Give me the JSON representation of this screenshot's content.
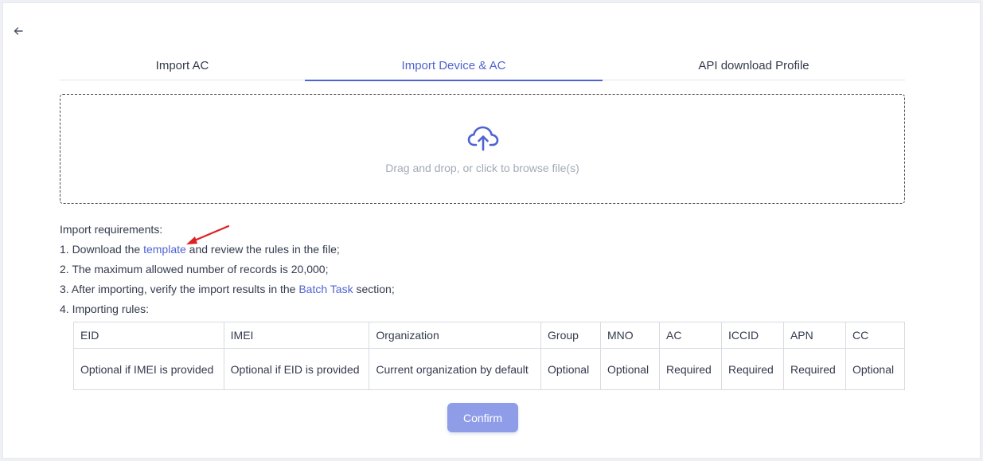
{
  "back": {
    "icon": "arrow-left-icon"
  },
  "tabs": [
    {
      "label": "Import AC",
      "active": false
    },
    {
      "label": "Import Device & AC",
      "active": true
    },
    {
      "label": "API download Profile",
      "active": false
    }
  ],
  "dropzone": {
    "icon": "cloud-upload-icon",
    "text": "Drag and drop, or click to browse file(s)"
  },
  "requirements": {
    "heading": "Import requirements:",
    "line1_prefix": "1. Download the ",
    "line1_link": "template",
    "line1_suffix": " and review the rules in the file;",
    "line2": "2. The maximum allowed number of records is 20,000;",
    "line3_prefix": "3. After importing, verify the import results in the ",
    "line3_link": "Batch Task",
    "line3_suffix": " section;",
    "line4": "4. Importing rules:"
  },
  "rules_table": {
    "headers": [
      "EID",
      "IMEI",
      "Organization",
      "Group",
      "MNO",
      "AC",
      "ICCID",
      "APN",
      "CC"
    ],
    "row": [
      "Optional if IMEI is provided",
      "Optional if EID is provided",
      "Current organization by default",
      "Optional",
      "Optional",
      "Required",
      "Required",
      "Required",
      "Optional"
    ]
  },
  "confirm_label": "Confirm",
  "colors": {
    "accent": "#4f63d2",
    "confirm_bg": "#8f9de8",
    "annotation_arrow": "#e02020"
  }
}
